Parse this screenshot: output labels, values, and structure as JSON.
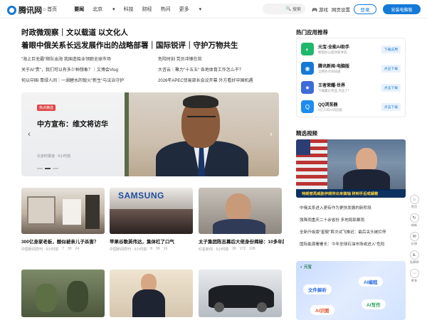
{
  "app": {
    "logo_text": "腾讯网"
  },
  "nav": {
    "items": [
      "首页",
      "要闻",
      "北京",
      "科技",
      "财经",
      "热问",
      "更多"
    ]
  },
  "top_actions": {
    "search_label": "搜索",
    "games": "游戏",
    "homepage_settings": "网页设置",
    "login": "登录",
    "pc_install": "安装电脑版"
  },
  "headlines": {
    "line1": "时政微观察｜文以载道 以文化人",
    "line2": "着眼中俄关系长远发展作出的战略部署｜国际锐评｜守护万物共生"
  },
  "sub_news": [
    "\"海上巨无霸\"顺队出海 我国造船业领跑全球市场",
    "危险时刻 党员冲锋在前",
    "关于AI\"贵\"，我们可以有多少种想象？｜文博会Vlog",
    "大咨云｜聚力\"十五五\" 各地体育工作怎么干？",
    "何以中国·青绿人间｜一湖碧水的锻火\"新生\"与法治守护",
    "2026年APEC贸易部长会议开幕 外方看好中国机遇"
  ],
  "carousel": {
    "tag": "热点精选",
    "title": "中方宣布：维文将访华",
    "meta": "北京时报道 · 5小时前"
  },
  "cards_row1": [
    {
      "title": "300亿身家老板，酸似被亲儿子杀害？",
      "source": "中国新闻周刊 · 5小时前",
      "likes": "7",
      "comments": "30",
      "shares": "24"
    },
    {
      "title": "苹果谷歌英伟达，集体杠了口气",
      "source": "中国新闻周刊 · 5小时前",
      "likes": "8",
      "comments": "36",
      "shares": "19"
    },
    {
      "title": "太子集团陈志幕后大佬身份揭秘：10多年前公安部挂牌督办的案件头目之一",
      "source": "红星新闻 · 5小时前",
      "likes": "30",
      "comments": "172",
      "shares": "108"
    }
  ],
  "sidebar": {
    "apps_title": "热门应用推荐",
    "apps": [
      {
        "name": "元宝-全能AI助手",
        "desc": "解锁办公提效新体验",
        "button": "下载试用",
        "color": "#1fb86b"
      },
      {
        "name": "腾讯新闻-电脑版",
        "desc": "全网热点早知道",
        "button": "点击下载",
        "color": "#1479d7"
      },
      {
        "name": "王者荣耀-世界",
        "desc": "下载赢价奖品 点击了！",
        "button": "点击下载",
        "color": "#3d6bd8"
      },
      {
        "name": "QQ浏览器",
        "desc": "4亿人的AI浏览器",
        "button": "点击下载",
        "color": "#1d8cf0"
      }
    ],
    "video_title": "精选视频",
    "video_caption": "特朗普再威胁伊朗突出来搞轴 称到手后或解散",
    "video_list": [
      "中俄关系进入更有作为更快发展的新阶段",
      "强降雨重庆二十余省份 多地局部暴雨",
      "全新升级版\"星舰\"首次试飞推迟：最后关头被拦停",
      "国际能源署署长：今年全球石油市场或进入\"危险"
    ],
    "promo_pills": [
      "文件解析",
      "AI编程",
      "AI识图",
      "AI写作"
    ],
    "promo_brand": "元宝"
  },
  "float_bar": [
    "首页",
    "刷新",
    "反馈",
    "无障碍",
    "更多"
  ]
}
